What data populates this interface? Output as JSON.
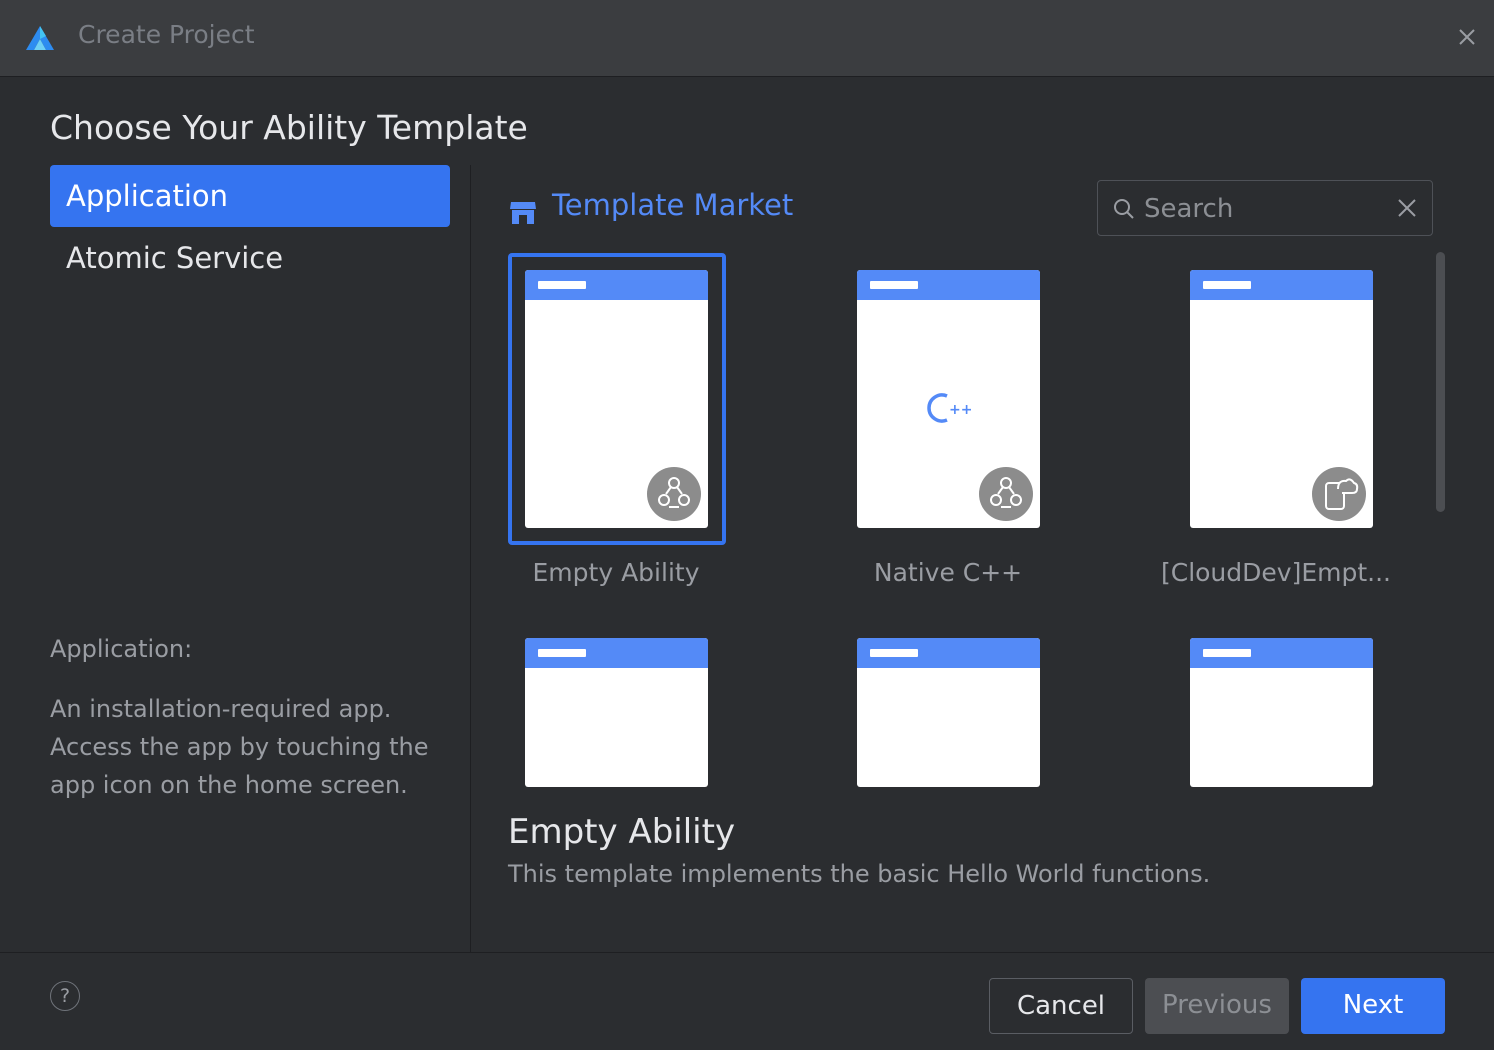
{
  "window": {
    "title": "Create Project"
  },
  "heading": "Choose Your Ability Template",
  "sidebar": {
    "items": [
      {
        "label": "Application",
        "active": true
      },
      {
        "label": "Atomic Service",
        "active": false
      }
    ],
    "description_title": "Application:",
    "description_body": "An installation-required app. Access the app by touching the app icon on the home screen."
  },
  "market": {
    "label": "Template Market",
    "icon": "store-icon"
  },
  "search": {
    "placeholder": "Search",
    "value": ""
  },
  "templates": [
    {
      "label": "Empty Ability",
      "badge": "ability-icon",
      "selected": true
    },
    {
      "label": "Native C++",
      "badge": "ability-icon",
      "center_icon": "cpp-icon",
      "center_text": "++"
    },
    {
      "label": "[CloudDev]Empt...",
      "badge": "cloud-dev-icon"
    },
    {
      "label": ""
    },
    {
      "label": ""
    },
    {
      "label": ""
    }
  ],
  "detail": {
    "title": "Empty Ability",
    "description": "This template implements the basic Hello World functions."
  },
  "footer": {
    "help": "?",
    "cancel": "Cancel",
    "previous": "Previous",
    "next": "Next"
  },
  "colors": {
    "accent": "#3574f0",
    "card_header": "#548af7",
    "background": "#2b2d30",
    "titlebar": "#3b3d40"
  }
}
